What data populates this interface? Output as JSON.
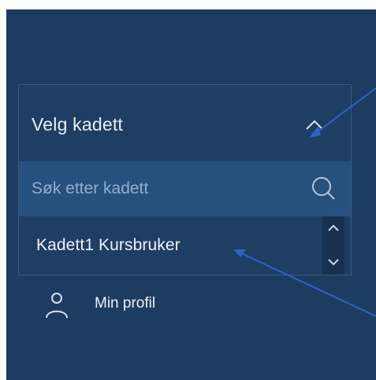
{
  "dropdown": {
    "label": "Velg kadett",
    "expanded_icon": "chevron-up-icon",
    "search": {
      "placeholder": "Søk etter kadett",
      "value": "",
      "icon": "search-icon"
    },
    "items": [
      {
        "label": "Kadett1 Kursbruker"
      }
    ],
    "scrollbar": {
      "up_icon": "chevron-up-icon",
      "down_icon": "chevron-down-icon"
    }
  },
  "profile": {
    "label": "Min profil",
    "icon": "user-icon"
  },
  "colors": {
    "panel_bg": "#1d3c61",
    "search_bg": "#26507e",
    "text": "#eef3f8",
    "placeholder": "#93aed0",
    "annotation_line": "#2f63c8"
  }
}
